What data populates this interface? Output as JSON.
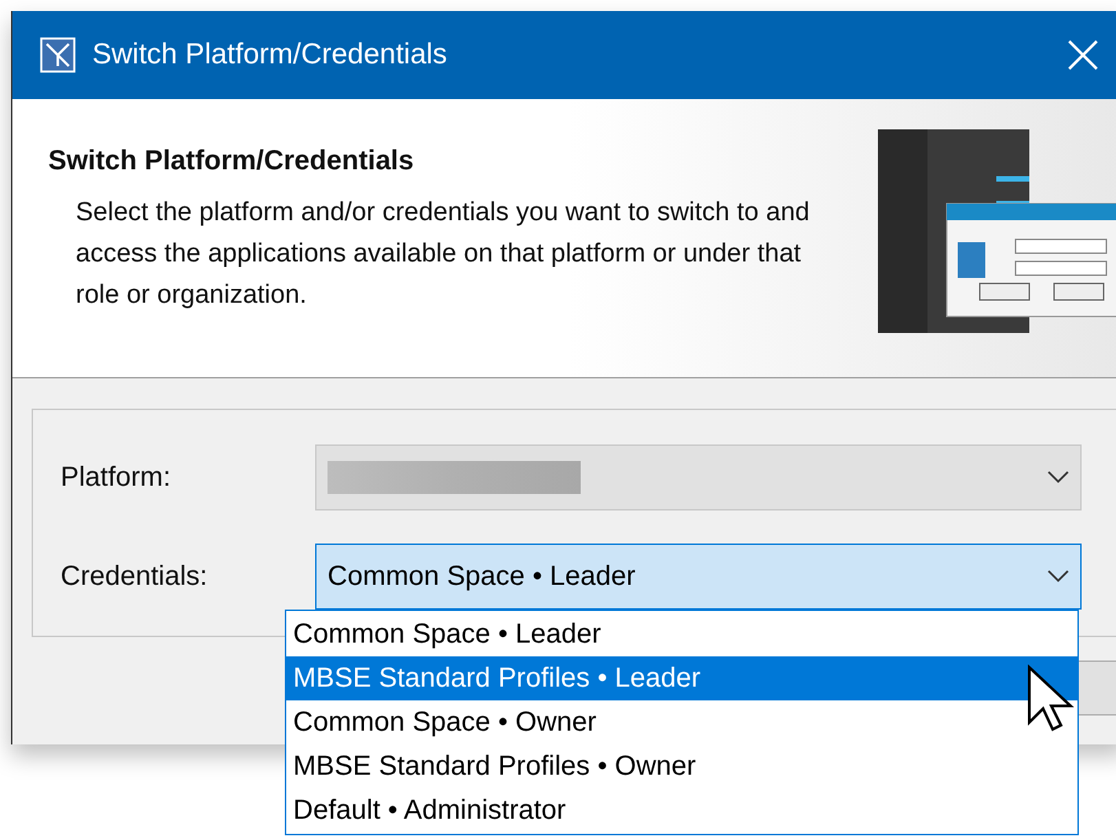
{
  "window": {
    "title": "Switch Platform/Credentials"
  },
  "header": {
    "title": "Switch Platform/Credentials",
    "description": "Select the platform and/or credentials you want to switch to and access the applications available on that platform or under that role or organization."
  },
  "fields": [
    {
      "label": "Platform:",
      "kind": "disabled"
    },
    {
      "label": "Credentials:",
      "kind": "focused",
      "value": "Common Space • Leader",
      "expanded": true
    }
  ],
  "dropdown": {
    "options": [
      {
        "label": "Common Space • Leader",
        "selected": false
      },
      {
        "label": "MBSE Standard Profiles • Leader",
        "selected": true
      },
      {
        "label": "Common Space • Owner",
        "selected": false
      },
      {
        "label": "MBSE Standard Profiles • Owner",
        "selected": false
      },
      {
        "label": "Default • Administrator",
        "selected": false
      }
    ]
  }
}
